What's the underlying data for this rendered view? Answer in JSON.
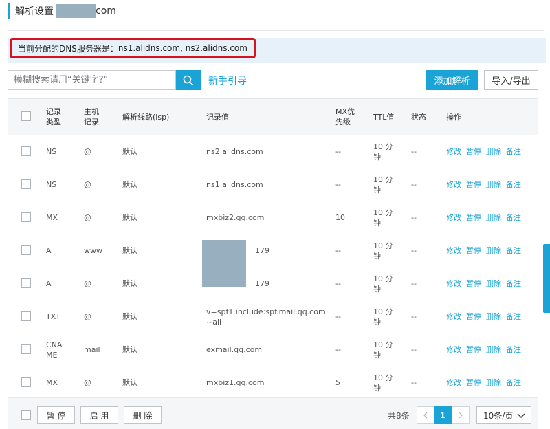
{
  "header": {
    "title": "解析设置",
    "tld": "com"
  },
  "notice": {
    "label": "当前分配的DNS服务器是：",
    "servers": "ns1.alidns.com, ns2.alidns.com"
  },
  "toolbar": {
    "search_placeholder": "模糊搜索请用“关键字?”",
    "guide_label": "新手引导",
    "add_label": "添加解析",
    "import_export_label": "导入/导出",
    "search_icon": "search-icon"
  },
  "table": {
    "headers": {
      "type": [
        "记录",
        "类型"
      ],
      "host": [
        "主机",
        "记录"
      ],
      "line": "解析线路(isp)",
      "value": "记录值",
      "mx": [
        "MX优",
        "先级"
      ],
      "ttl": "TTL值",
      "status": "状态",
      "ops": "操作"
    },
    "ops": {
      "edit": "修改",
      "pause": "暂停",
      "delete": "删除",
      "note": "备注"
    },
    "ttl": [
      "10 分",
      "钟"
    ],
    "rows": [
      {
        "type": "NS",
        "host": "@",
        "line": "默认",
        "value": "ns2.alidns.com",
        "mx": "--",
        "status": "--"
      },
      {
        "type": "NS",
        "host": "@",
        "line": "默认",
        "value": "ns1.alidns.com",
        "mx": "--",
        "status": "--"
      },
      {
        "type": "MX",
        "host": "@",
        "line": "默认",
        "value": "mxbiz2.qq.com",
        "mx": "10",
        "status": "--"
      },
      {
        "type": "A",
        "host": "www",
        "line": "默认",
        "value": "179",
        "mx": "--",
        "status": "--"
      },
      {
        "type": "A",
        "host": "@",
        "line": "默认",
        "value": "179",
        "mx": "--",
        "status": "--"
      },
      {
        "type": "TXT",
        "host": "@",
        "line": "默认",
        "value": [
          "v=spf1 include:spf.mail.qq.com",
          "~all"
        ],
        "mx": "--",
        "status": "--"
      },
      {
        "type": [
          "CNA",
          "ME"
        ],
        "host": "mail",
        "line": "默认",
        "value": "exmail.qq.com",
        "mx": "--",
        "status": "--"
      },
      {
        "type": "MX",
        "host": "@",
        "line": "默认",
        "value": "mxbiz1.qq.com",
        "mx": "5",
        "status": "--"
      }
    ]
  },
  "footer": {
    "pause_label": "暂 停",
    "enable_label": "启 用",
    "delete_label": "删 除",
    "total_label": "共8条",
    "current_page": "1",
    "page_size": "10条/页"
  },
  "colors": {
    "accent": "#1aa3d6",
    "highlight_border": "#d6121c",
    "notice_bg": "#e6f1f9",
    "mask": "#97afbf"
  }
}
